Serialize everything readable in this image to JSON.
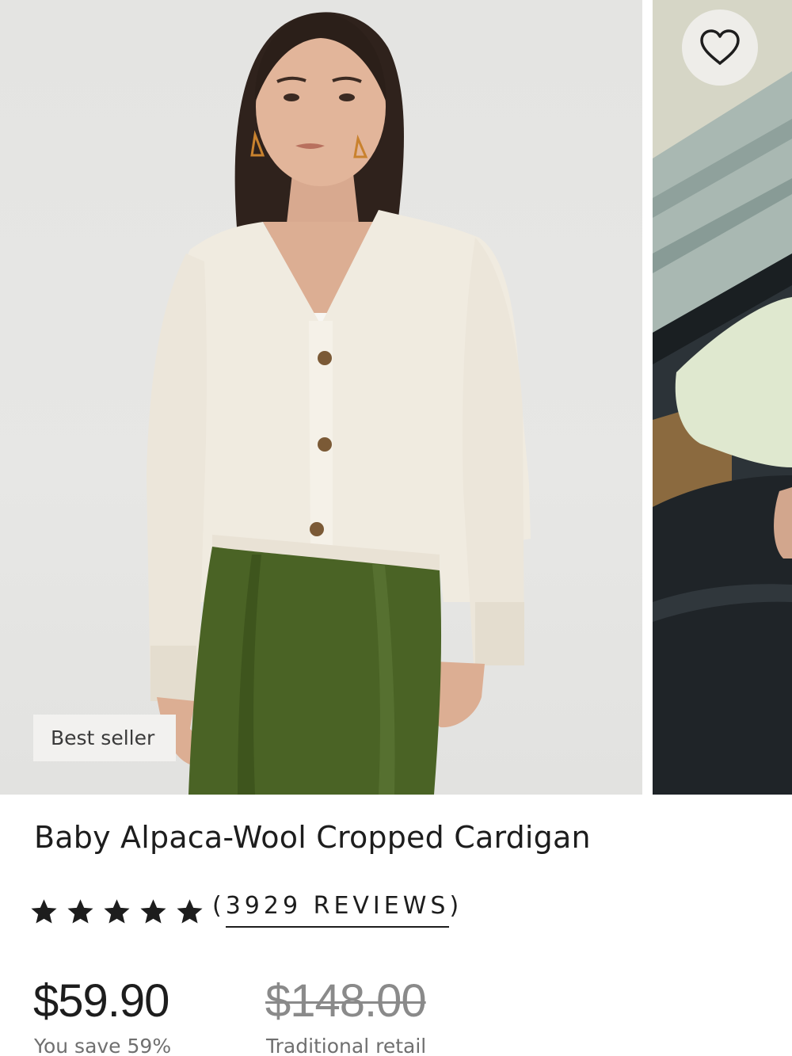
{
  "product": {
    "badge": "Best seller",
    "title": "Baby Alpaca-Wool Cropped Cardigan",
    "rating": {
      "stars": 5,
      "reviews_open": "(",
      "reviews_count": "3929 REVIEWS",
      "reviews_close": ")"
    },
    "price": "$59.90",
    "savings": "You save 59%",
    "retail_price": "$148.00",
    "retail_label": "Traditional retail"
  },
  "icons": {
    "favorite": "heart-outline-icon",
    "rating": "star-icon"
  },
  "colors": {
    "text": "#1d1d1d",
    "muted": "#6f6f6f",
    "strikethrough": "#8a8a8a",
    "badge_bg": "#f2f1ef",
    "fav_bg": "#eeede9"
  }
}
